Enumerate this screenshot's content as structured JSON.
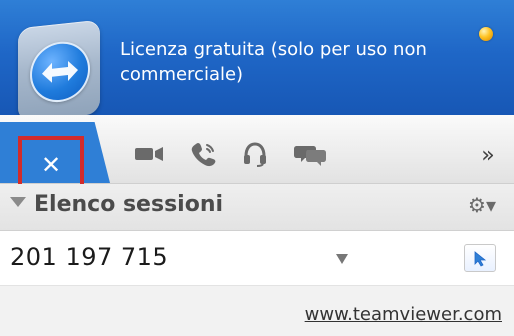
{
  "header": {
    "license_text": "Licenza gratuita (solo per uso non commerciale)"
  },
  "toolbar": {
    "close_symbol": "✕",
    "icons": [
      "video-camera-icon",
      "phone-icon",
      "headset-icon",
      "chat-icon"
    ],
    "more_symbol": "»"
  },
  "sessions": {
    "title": "Elenco sessioni",
    "session_id": "201 197 715"
  },
  "footer": {
    "link": "www.teamviewer.com"
  },
  "colors": {
    "header_blue": "#1f67c7",
    "highlight_red": "#d22b2b"
  }
}
